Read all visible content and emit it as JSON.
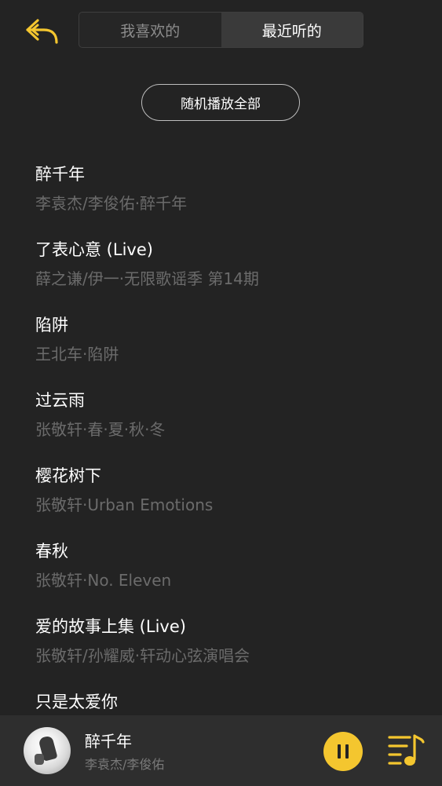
{
  "header": {
    "back_icon": "back-arrow-icon",
    "tabs": [
      {
        "label": "我喜欢的",
        "active": false
      },
      {
        "label": "最近听的",
        "active": true
      }
    ]
  },
  "shuffle_label": "随机播放全部",
  "songs": [
    {
      "title": "醉千年",
      "subtitle": "李袁杰/李俊佑·醉千年"
    },
    {
      "title": "了表心意 (Live)",
      "subtitle": "薛之谦/伊一·无限歌谣季 第14期"
    },
    {
      "title": "陷阱",
      "subtitle": "王北车·陷阱"
    },
    {
      "title": "过云雨",
      "subtitle": "张敬轩·春·夏·秋·冬"
    },
    {
      "title": "樱花树下",
      "subtitle": "张敬轩·Urban Emotions"
    },
    {
      "title": "春秋",
      "subtitle": "张敬轩·No. Eleven"
    },
    {
      "title": "爱的故事上集 (Live)",
      "subtitle": "张敬轩/孙耀威·轩动心弦演唱会"
    },
    {
      "title": "只是太爱你",
      "subtitle": ""
    }
  ],
  "now_playing": {
    "title": "醉千年",
    "artist": "李袁杰/李俊佑",
    "pause_icon": "pause-icon",
    "playlist_icon": "playlist-music-icon"
  },
  "colors": {
    "accent": "#f4c62f",
    "background": "#232323",
    "player_bg": "#2e2e2e",
    "subtitle": "#6b6b6b"
  }
}
